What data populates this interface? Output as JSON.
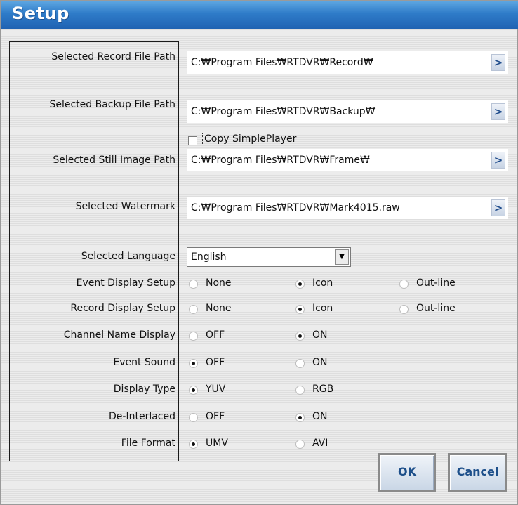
{
  "window": {
    "title": "Setup"
  },
  "paths": [
    {
      "label": "Selected Record File Path",
      "value": "C:₩Program Files₩RTDVR₩Record₩"
    },
    {
      "label": "Selected Backup File Path",
      "value": "C:₩Program Files₩RTDVR₩Backup₩"
    },
    {
      "label": "Selected Still Image Path",
      "value": "C:₩Program Files₩RTDVR₩Frame₩"
    },
    {
      "label": "Selected Watermark",
      "value": "C:₩Program Files₩RTDVR₩Mark4015.raw"
    }
  ],
  "browse_label": ">",
  "copy_simpleplayer": {
    "label": "Copy SimplePlayer",
    "checked": false
  },
  "language": {
    "label": "Selected Language",
    "value": "English"
  },
  "options": [
    {
      "label": "Event Display Setup",
      "choices": [
        "None",
        "Icon",
        "Out-line"
      ],
      "selected": "Icon"
    },
    {
      "label": "Record Display Setup",
      "choices": [
        "None",
        "Icon",
        "Out-line"
      ],
      "selected": "Icon"
    },
    {
      "label": "Channel Name Display",
      "choices": [
        "OFF",
        "ON"
      ],
      "selected": "ON"
    },
    {
      "label": "Event Sound",
      "choices": [
        "OFF",
        "ON"
      ],
      "selected": "OFF"
    },
    {
      "label": "Display Type",
      "choices": [
        "YUV",
        "RGB"
      ],
      "selected": "YUV"
    },
    {
      "label": "De-Interlaced",
      "choices": [
        "OFF",
        "ON"
      ],
      "selected": "ON"
    },
    {
      "label": "File Format",
      "choices": [
        "UMV",
        "AVI"
      ],
      "selected": "UMV"
    }
  ],
  "buttons": {
    "ok": "OK",
    "cancel": "Cancel"
  }
}
